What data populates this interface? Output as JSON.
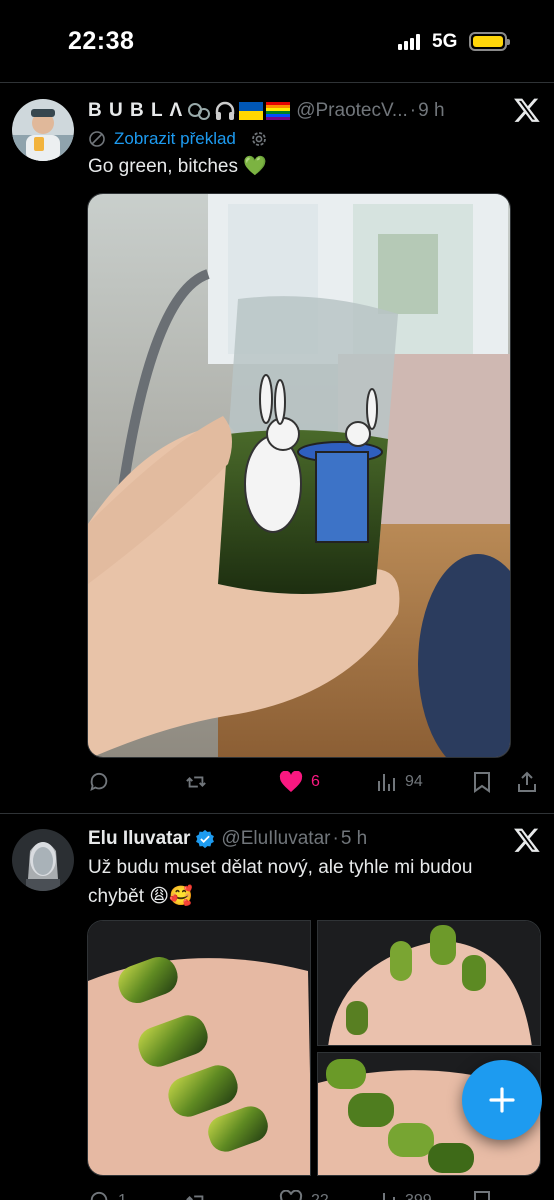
{
  "status_bar": {
    "time": "22:38",
    "network": "5G"
  },
  "tweets": [
    {
      "display_name": "B U B L Λ",
      "handle": "@PraotecV...",
      "separator": "·",
      "time": "9 h",
      "translate_label": "Zobrazit překlad",
      "text": "Go green, bitches 💚",
      "media_description": "photo",
      "stats": {
        "replies": "",
        "reposts": "",
        "likes": "6",
        "views": "94"
      },
      "liked": true
    },
    {
      "display_name": "Elu Iluvatar",
      "verified": true,
      "handle": "@EluIluvatar",
      "separator": "·",
      "time": "5 h",
      "text_line1": "Už budu muset dělat nový, ale tyhle mi budou",
      "text_line2": "chybět 😩🥰",
      "stats": {
        "replies": "1",
        "reposts": "",
        "likes": "22",
        "views": "399"
      }
    }
  ],
  "colors": {
    "accent": "#1d9bf0",
    "like": "#f91880",
    "muted": "#71767b",
    "text": "#e7e9ea",
    "background": "#000000"
  }
}
